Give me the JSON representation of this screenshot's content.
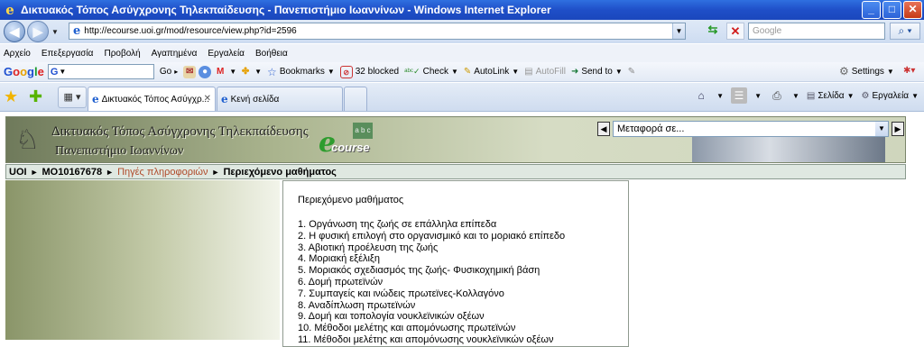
{
  "window": {
    "title": "Δικτυακός Τόπος Ασύγχρονης Τηλεκπαίδευσης - Πανεπιστήμιο Ιωαννίνων - Windows Internet Explorer",
    "minimize": "_",
    "maximize": "□",
    "close": "✕"
  },
  "address": {
    "url": "http://ecourse.uoi.gr/mod/resource/view.php?id=2596",
    "search_placeholder": "Google"
  },
  "menu": [
    "Αρχείο",
    "Επεξεργασία",
    "Προβολή",
    "Αγαπημένα",
    "Εργαλεία",
    "Βοήθεια"
  ],
  "google_toolbar": {
    "logo": "Google",
    "search_prefix": "G",
    "go": "Go",
    "bookmarks": "Bookmarks",
    "blocked": "32 blocked",
    "check": "Check",
    "autolink": "AutoLink",
    "autofill": "AutoFill",
    "sendto": "Send to",
    "settings": "Settings"
  },
  "tabs": [
    {
      "label": "Δικτυακός Τόπος Ασύγχρ..."
    },
    {
      "label": "Κενή σελίδα"
    }
  ],
  "command_bar": {
    "page": "Σελίδα",
    "tools": "Εργαλεία"
  },
  "site": {
    "title": "Δικτυακός Τόπος Ασύγχρονης Τηλεκπαίδευσης",
    "subtitle": "Πανεπιστήμιο Ιωαννίνων",
    "logo_text": "course",
    "logo_e": "e",
    "logo_abc": "a b c",
    "jump_label": "Μεταφορά σε..."
  },
  "breadcrumb": {
    "home": "UOI",
    "course": "MO10167678",
    "section": "Πηγές πληροφοριών",
    "current": "Περιεχόμενο μαθήματος",
    "separator": "►"
  },
  "content": {
    "heading": "Περιεχόμενο μαθήματος",
    "items": [
      "1. Οργάνωση της ζωής σε επάλληλα επίπεδα",
      "2. Η φυσική επιλογή στο οργανισμικό και το μοριακό επίπεδο",
      "3. Αβιοτική προέλευση της ζωής",
      "4. Μοριακή εξέλιξη",
      "5. Μοριακός σχεδιασμός της ζωής- Φυσικοχημική βάση",
      "6. Δομή πρωτεϊνών",
      "7. Συμπαγείς και ινώδεις πρωτεϊνες-Κολλαγόνο",
      "8. Αναδίπλωση πρωτεϊνών",
      "9. Δομή και τοπολογία νουκλεϊνικών οξέων",
      "10. Μέθοδοι μελέτης και απομόνωσης πρωτεϊνών",
      "11. Μέθοδοι μελέτης και απομόνωσης νουκλεϊνικών οξέων"
    ]
  },
  "colors": {
    "titlebar": "#1f4fc8",
    "breadcrumb_link": "#b04a2a",
    "header_bg": "#aab48e"
  }
}
